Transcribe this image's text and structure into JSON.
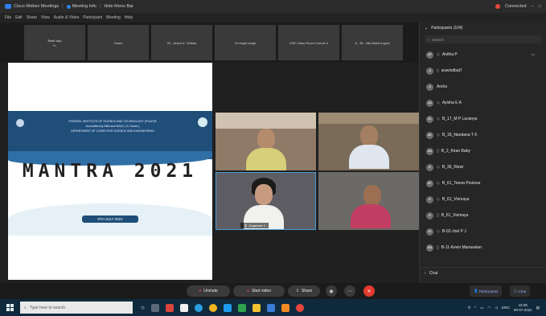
{
  "titlebar": {
    "app_title": "Cisco Webex Meetings",
    "meeting_info": "Meeting Info",
    "hide_menu": "Hide Menu Bar",
    "connection": "Connected"
  },
  "menubar": [
    "File",
    "Edit",
    "Share",
    "View",
    "Audio & Video",
    "Participant",
    "Meeting",
    "Help"
  ],
  "strip": [
    {
      "name": "Basil saju",
      "sub": "Ho"
    },
    {
      "name": "Grace",
      "sub": ""
    },
    {
      "name": "20 - Anton K. Shibas",
      "sub": ""
    },
    {
      "name": "24 Angel shaju",
      "sub": ""
    },
    {
      "name": "CSE Class Room Comrin 4",
      "sub": ""
    },
    {
      "name": "A - 35 - Aibi Maria Lopez",
      "sub": ""
    }
  ],
  "slide": {
    "institute": "FEDERAL INSTITUTE OF SCIENCE AND TECHNOLOGY (FISAT)®",
    "accreditation": "Accredited by NBA and NAAC [ A' Grade ]",
    "department": "DEPARTMENT OF COMPUTER SCIENCE AND ENGINEERING",
    "title": "MANTRA 2021",
    "date": "9TH JULY 2021"
  },
  "videos": {
    "v3_label": "Organizer 1"
  },
  "panel": {
    "header": "Participants (104)",
    "search_placeholder": "Search",
    "participants": [
      {
        "initials": "AP",
        "name": "Anitha P"
      },
      {
        "initials": "A",
        "name": "aravindbal7"
      },
      {
        "initials": "A",
        "name": "Arsha"
      },
      {
        "initials": "AA",
        "name": "Ayisha E A"
      },
      {
        "initials": "BL",
        "name": "B_17_M P Lavanya"
      },
      {
        "initials": "BK",
        "name": "B_18_Nandana T K"
      },
      {
        "initials": "BB",
        "name": "B_2_Kiran Baby"
      },
      {
        "initials": "B",
        "name": "B_36_Rizwi"
      },
      {
        "initials": "BP",
        "name": "B_61_Teena Poulose"
      },
      {
        "initials": "B",
        "name": "B_61_Vismaya"
      },
      {
        "initials": "B",
        "name": "B_61_Vismaya"
      },
      {
        "initials": "BJ",
        "name": "B-02-Joel P J"
      },
      {
        "initials": "BM",
        "name": "B-11-Kevin Manavalan"
      }
    ],
    "chat_label": "Chat"
  },
  "controls": {
    "unmute": "Unmute",
    "start_video": "Start video",
    "share": "Share",
    "participants": "Participants",
    "chat": "Chat"
  },
  "taskbar": {
    "search_placeholder": "Type here to search",
    "lang": "ENG",
    "time": "15:05",
    "date": "09-07-2021"
  }
}
